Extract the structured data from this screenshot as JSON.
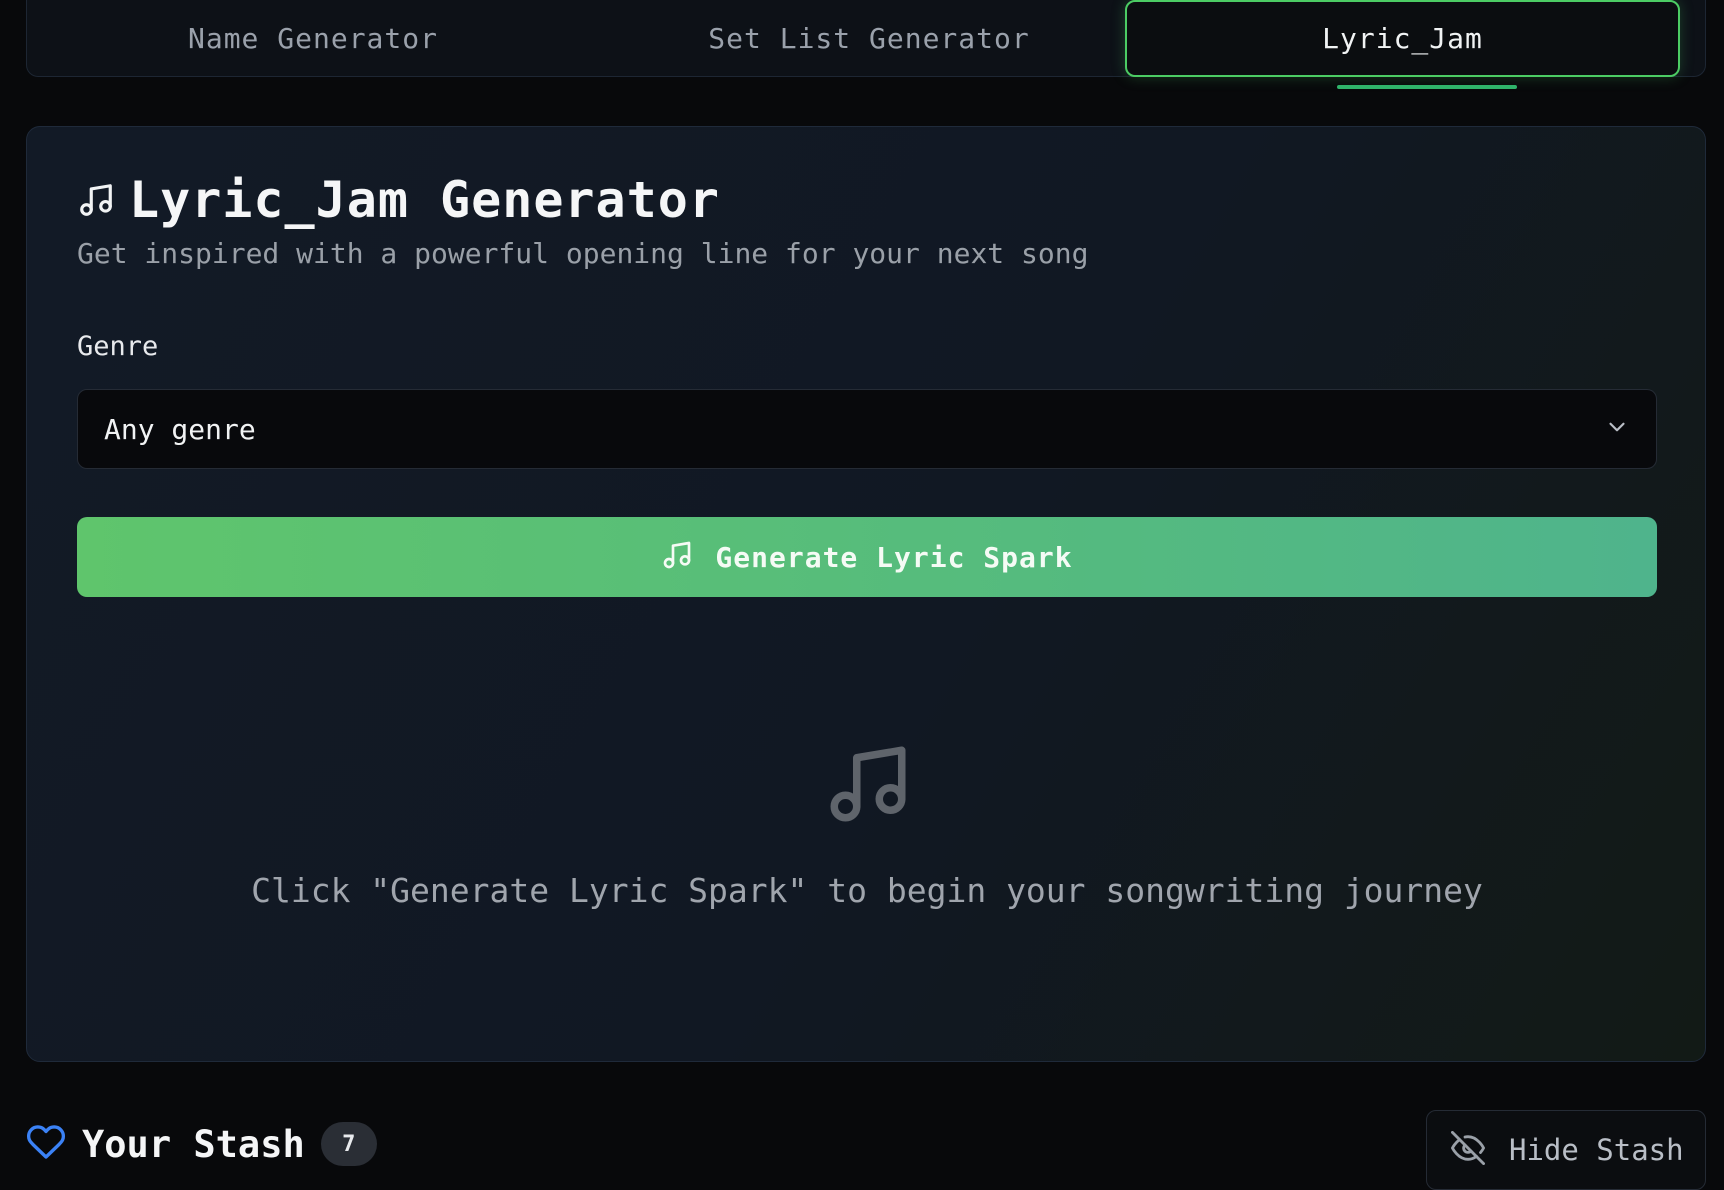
{
  "tabs": [
    {
      "label": "Name Generator",
      "active": false
    },
    {
      "label": "Set List Generator",
      "active": false
    },
    {
      "label": "Lyric_Jam",
      "active": true
    }
  ],
  "card": {
    "title": "Lyric_Jam Generator",
    "subtitle": "Get inspired with a powerful opening line for your next song",
    "genre_label": "Genre",
    "genre_select": {
      "value": "Any genre"
    },
    "generate_button": {
      "label": "Generate Lyric Spark"
    },
    "empty_state": {
      "text": "Click \"Generate Lyric Spark\" to begin your songwriting journey"
    }
  },
  "stash": {
    "title": "Your Stash",
    "count": "7",
    "hide_button": {
      "label": "Hide Stash"
    }
  },
  "colors": {
    "accent_green": "#4ccc64",
    "button_gradient_start": "#5fc56c",
    "button_gradient_end": "#4fb48c",
    "stash_heart_blue": "#3b82f6"
  },
  "icons": {
    "title_icon": "music-note-icon",
    "button_icon": "music-note-icon",
    "empty_icon": "music-note-icon",
    "select_icon": "chevron-down-icon",
    "stash_icon": "heart-icon",
    "hide_icon": "eye-off-icon"
  }
}
